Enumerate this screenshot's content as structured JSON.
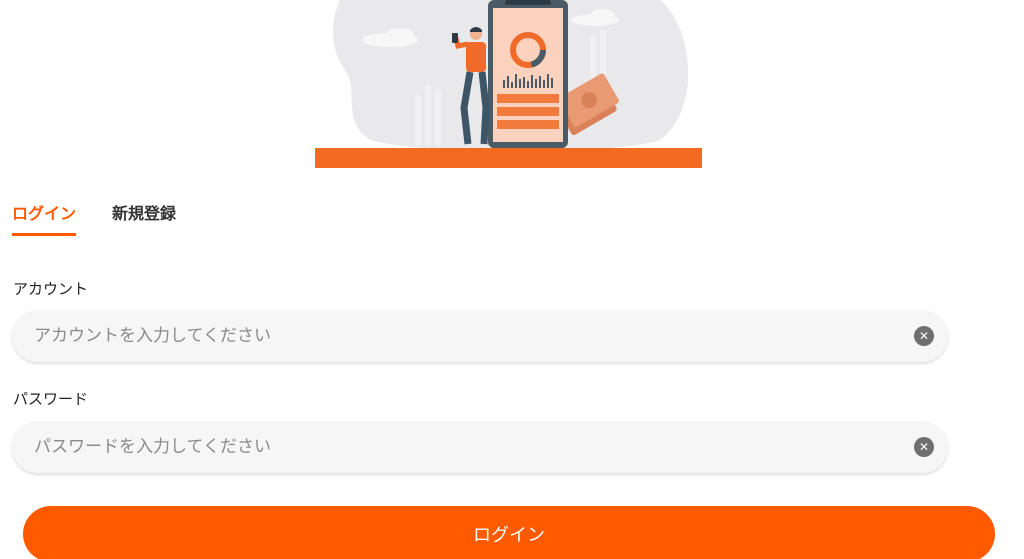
{
  "tabs": [
    {
      "label": "ログイン",
      "active": true
    },
    {
      "label": "新規登録",
      "active": false
    }
  ],
  "account": {
    "label": "アカウント",
    "placeholder": "アカウントを入力してください",
    "value": ""
  },
  "password": {
    "label": "パスワード",
    "placeholder": "パスワードを入力してください",
    "value": ""
  },
  "submit": {
    "label": "ログイン"
  },
  "icons": {
    "clear": "clear-icon"
  },
  "colors": {
    "accent": "#ff5a00",
    "field_bg": "#f6f6f6",
    "clear_icon": "#6f6f6f"
  }
}
